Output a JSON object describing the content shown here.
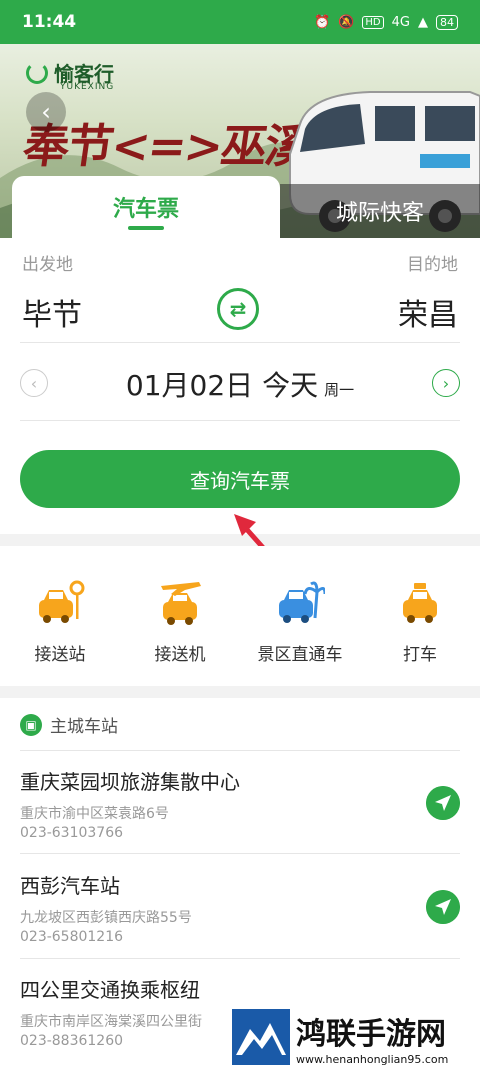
{
  "status": {
    "time": "11:44",
    "signal": "4G",
    "battery": "84"
  },
  "banner": {
    "brand_name": "愉客行",
    "brand_sub": "YUKEXING",
    "headline": "奉节<=>巫溪"
  },
  "tabs": [
    {
      "label": "汽车票",
      "active": true
    },
    {
      "label": "城际快客",
      "active": false
    }
  ],
  "search": {
    "from_label": "出发地",
    "to_label": "目的地",
    "from_city": "毕节",
    "to_city": "荣昌",
    "date": "01月02日 今天",
    "weekday": "周一",
    "query_button": "查询汽车票"
  },
  "services": [
    {
      "label": "接送站",
      "icon": "pickup-station-car-icon"
    },
    {
      "label": "接送机",
      "icon": "pickup-airport-car-icon"
    },
    {
      "label": "景区直通车",
      "icon": "scenic-bus-icon"
    },
    {
      "label": "打车",
      "icon": "taxi-icon"
    }
  ],
  "stations_section": {
    "title": "主城车站",
    "items": [
      {
        "name": "重庆菜园坝旅游集散中心",
        "address": "重庆市渝中区菜袁路6号",
        "phone": "023-63103766"
      },
      {
        "name": "西彭汽车站",
        "address": "九龙坡区西彭镇西庆路55号",
        "phone": "023-65801216"
      },
      {
        "name": "四公里交通换乘枢纽",
        "address": "重庆市南岸区海棠溪四公里街",
        "phone": "023-88361260"
      }
    ]
  },
  "watermark": {
    "title": "鸿联手游网",
    "url": "www.henanhonglian95.com"
  },
  "colors": {
    "accent": "#2eaa4a",
    "annotation_arrow": "#e0283c"
  }
}
